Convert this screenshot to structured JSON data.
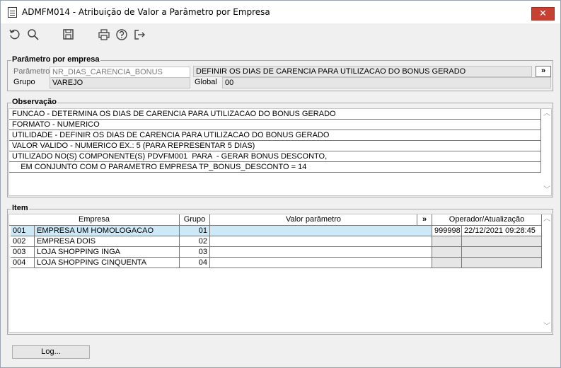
{
  "window": {
    "title": "ADMFM014 - Atribuição de Valor a Parâmetro por Empresa",
    "close_label": "✕"
  },
  "toolbar": {
    "icons": [
      "undo-icon",
      "search-icon",
      "save-icon",
      "print-icon",
      "help-icon",
      "exit-icon"
    ]
  },
  "parametro": {
    "legend": "Parâmetro por empresa",
    "parametro_label": "Parâmetro",
    "parametro_value": "NR_DIAS_CARENCIA_BONUS",
    "descricao_value": "DEFINIR OS DIAS DE CARENCIA PARA UTILIZACAO DO BONUS GERADO",
    "more_label": "»",
    "grupo_label": "Grupo",
    "grupo_value": "VAREJO",
    "global_label": "Global",
    "global_value": "00"
  },
  "observacao": {
    "legend": "Observação",
    "lines": [
      "FUNCAO - DETERMINA OS DIAS DE CARENCIA PARA UTILIZACAO DO BONUS GERADO",
      "FORMATO - NUMERICO",
      "UTILIDADE - DEFINIR OS DIAS DE CARENCIA PARA UTILIZACAO DO BONUS GERADO",
      "VALOR VALIDO - NUMERICO EX.: 5 (PARA REPRESENTAR 5 DIAS)",
      "UTILIZADO NO(S) COMPONENTE(S) PDVFM001  PARA  - GERAR BONUS DESCONTO,",
      "    EM CONJUNTO COM O PARAMETRO EMPRESA TP_BONUS_DESCONTO = 14"
    ]
  },
  "item": {
    "legend": "Item",
    "headers": {
      "empresa": "Empresa",
      "grupo": "Grupo",
      "valor": "Valor parâmetro",
      "more": "»",
      "operador": "Operador/Atualização"
    },
    "rows": [
      {
        "code": "001",
        "name": "EMPRESA UM HOMOLOGACAO",
        "grupo": "01",
        "valor": "",
        "operador": "999998",
        "data": "22/12/2021 09:28:45"
      },
      {
        "code": "002",
        "name": "EMPRESA DOIS",
        "grupo": "02",
        "valor": "",
        "operador": "",
        "data": ""
      },
      {
        "code": "003",
        "name": "LOJA SHOPPING INGA",
        "grupo": "03",
        "valor": "",
        "operador": "",
        "data": ""
      },
      {
        "code": "004",
        "name": "LOJA SHOPPING CINQUENTA",
        "grupo": "04",
        "valor": "",
        "operador": "",
        "data": ""
      }
    ]
  },
  "footer": {
    "log_label": "Log..."
  }
}
